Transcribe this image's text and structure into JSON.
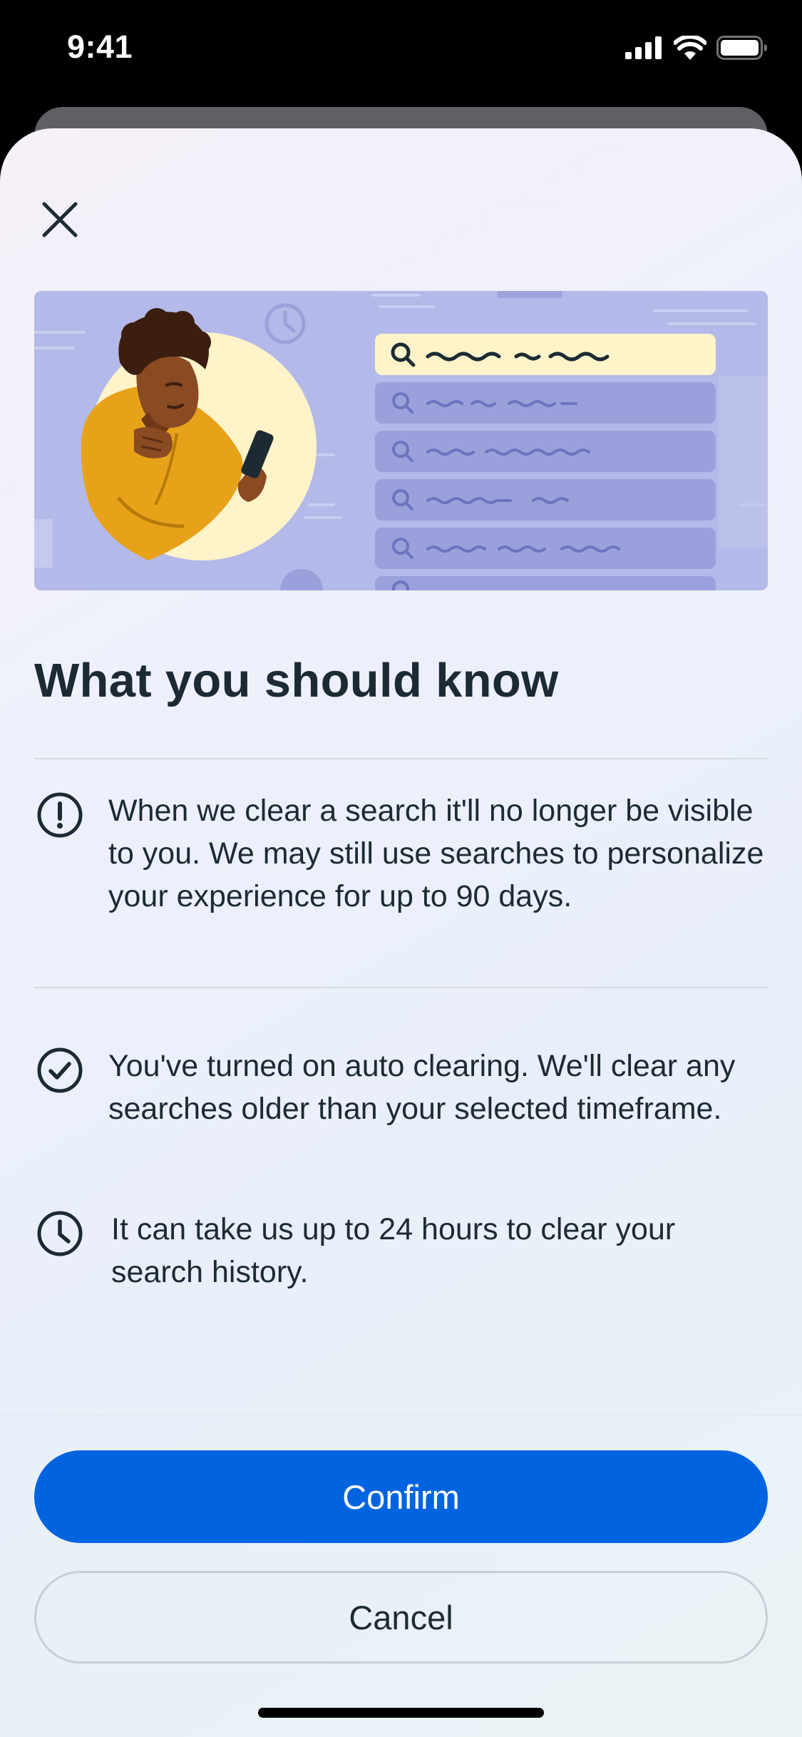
{
  "status_bar": {
    "time": "9:41"
  },
  "sheet": {
    "title": "What you should know",
    "info_items": [
      {
        "icon": "alert-circle-icon",
        "text": "When we clear a search it'll no longer be visible to you. We may still use searches to personalize your experience for up to 90 days."
      },
      {
        "icon": "check-circle-icon",
        "text": "You've turned on auto clearing. We'll clear any searches older than your selected timeframe."
      },
      {
        "icon": "clock-icon",
        "text": "It can take us up to 24 hours to clear your search history."
      }
    ],
    "confirm_label": "Confirm",
    "cancel_label": "Cancel"
  },
  "colors": {
    "primary": "#0064e0",
    "text": "#1c2b33",
    "illustration_bg": "#b3b9e8",
    "illustration_sweater": "#e8a21a"
  }
}
